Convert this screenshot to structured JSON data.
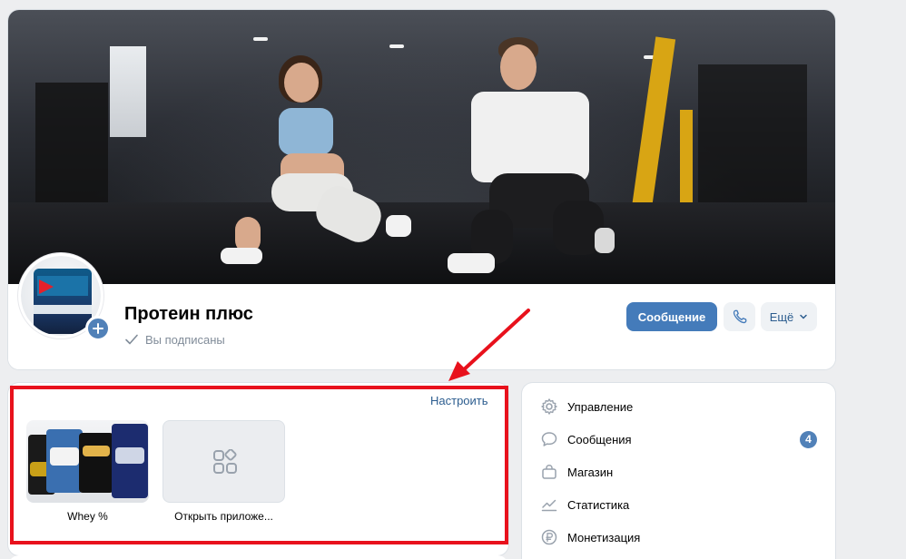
{
  "group": {
    "name": "Протеин плюс",
    "subscribed_status": "Вы подписаны"
  },
  "actions": {
    "message_label": "Сообщение",
    "more_label": "Ещё"
  },
  "apps": {
    "configure_label": "Настроить",
    "items": [
      {
        "label": "Whey %"
      },
      {
        "label": "Открыть приложе..."
      }
    ]
  },
  "side_menu": {
    "items": [
      {
        "label": "Управление",
        "icon": "gear-icon"
      },
      {
        "label": "Сообщения",
        "icon": "message-icon",
        "badge": "4"
      },
      {
        "label": "Магазин",
        "icon": "shop-bag-icon"
      },
      {
        "label": "Статистика",
        "icon": "stats-icon"
      },
      {
        "label": "Монетизация",
        "icon": "ruble-icon"
      }
    ]
  },
  "colors": {
    "accent": "#447bba",
    "link": "#2c5d8f",
    "highlight": "#e8111c",
    "background": "#edeef0"
  }
}
